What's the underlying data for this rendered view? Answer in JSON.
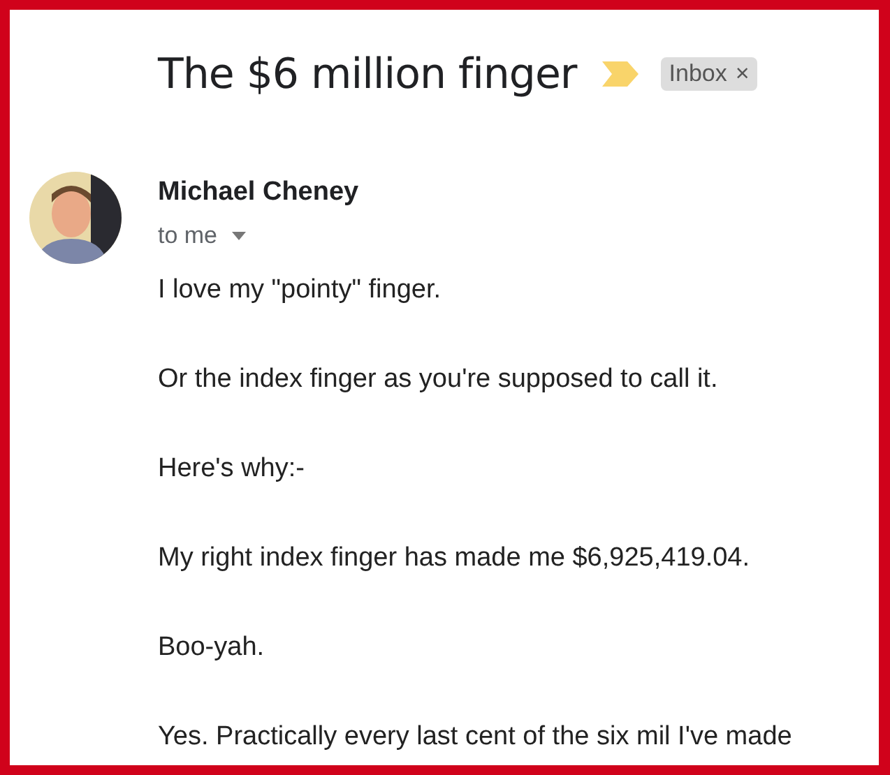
{
  "subject": "The $6 million finger",
  "label": {
    "text": "Inbox",
    "remove": "×"
  },
  "sender": {
    "name": "Michael Cheney",
    "recipient": "to me"
  },
  "body": [
    "I love my \"pointy\" finger.",
    "Or the index finger as you're supposed to call it.",
    "Here's why:-",
    "My right index finger has made me $6,925,419.04.",
    "Boo-yah.",
    "Yes. Practically every last cent of the six mil I've made"
  ]
}
